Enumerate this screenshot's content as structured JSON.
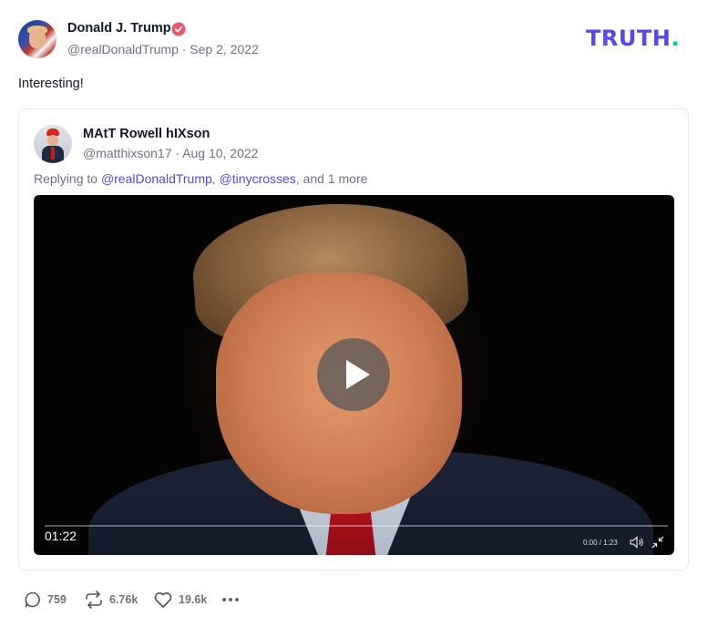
{
  "post": {
    "author_name": "Donald J. Trump",
    "author_meta": "@realDonaldTrump · Sep 2, 2022",
    "text": "Interesting!",
    "brand": "TRUTH",
    "brand_dot": "."
  },
  "quote": {
    "author_name": "MAtT Rowell hIXson",
    "author_meta": "@matthixson17 · Aug 10, 2022",
    "reply_prefix": "Replying to ",
    "mention_1": "@realDonaldTrump",
    "separator": ", ",
    "mention_2": "@tinycrosses",
    "reply_suffix": ", and 1 more",
    "video": {
      "duration": "01:22",
      "time_display": "0:00 / 1:23"
    }
  },
  "actions": {
    "replies": "759",
    "retruths": "6.76k",
    "likes": "19.6k"
  },
  "icons": [
    "verified-icon",
    "play-icon",
    "volume-icon",
    "minimize-icon",
    "reply-icon",
    "retruth-icon",
    "heart-icon",
    "more-icon"
  ],
  "colors": {
    "brand": "#5448ee",
    "brand_dot": "#00d1a0",
    "verified": "#e8546c",
    "muted_text": "#6b7280"
  }
}
